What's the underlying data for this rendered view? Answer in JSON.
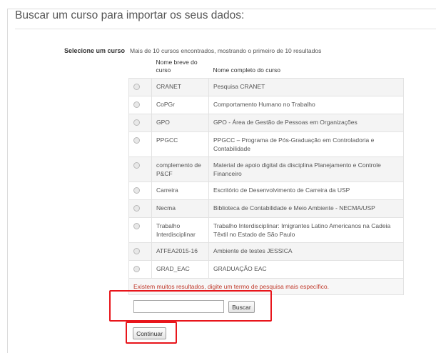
{
  "fieldset": {
    "legend": "Buscar um curso para importar os seus dados:"
  },
  "course_select": {
    "label": "Selecione um curso",
    "status": "Mais de 10 cursos encontrados, mostrando o primeiro de 10 resultados",
    "columns": {
      "short_name": "Nome breve do curso",
      "full_name": "Nome completo do curso"
    },
    "rows": [
      {
        "short": "CRANET",
        "full": "Pesquisa CRANET"
      },
      {
        "short": "CoPGr",
        "full": "Comportamento Humano no Trabalho"
      },
      {
        "short": "GPO",
        "full": "GPO - Área de Gestão de Pessoas em Organizações"
      },
      {
        "short": "PPGCC",
        "full": "PPGCC – Programa de Pós-Graduação em Controladoria e Contabilidade"
      },
      {
        "short": "complemento de P&CF",
        "full": "Material de apoio digital da disciplina Planejamento e Controle Financeiro"
      },
      {
        "short": "Carreira",
        "full": "Escritório de Desenvolvimento de Carreira da USP"
      },
      {
        "short": "Necma",
        "full": "Biblioteca de Contabilidade e Meio Ambiente - NECMA/USP"
      },
      {
        "short": "Trabalho Interdisciplinar",
        "full": "Trabalho Interdisciplinar: Imigrantes Latino Americanos na Cadeia Têxtil no Estado de São Paulo"
      },
      {
        "short": "ATFEA2015-16",
        "full": "Ambiente de testes JESSICA"
      },
      {
        "short": "GRAD_EAC",
        "full": "GRADUAÇÃO EAC"
      }
    ],
    "too_many_warning": "Existem muitos resultados, digite um termo de pesquisa mais específico."
  },
  "search": {
    "input_value": "",
    "button_label": "Buscar"
  },
  "actions": {
    "continue_label": "Continuar"
  },
  "colors": {
    "highlight": "#e8151b",
    "warning_text": "#c0392b"
  }
}
